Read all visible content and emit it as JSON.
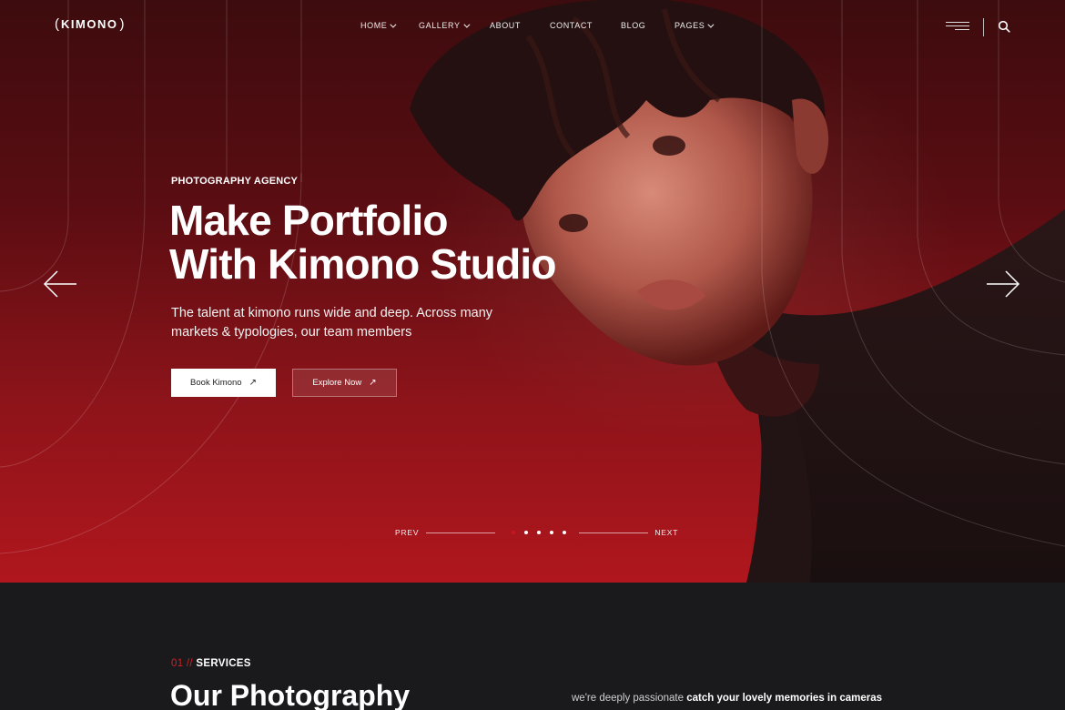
{
  "brand": {
    "logo_text": "KIMONO"
  },
  "nav": {
    "items": [
      {
        "label": "HOME",
        "dropdown": true
      },
      {
        "label": "GALLERY",
        "dropdown": true
      },
      {
        "label": "ABOUT",
        "dropdown": false
      },
      {
        "label": "CONTACT",
        "dropdown": false
      },
      {
        "label": "BLOG",
        "dropdown": false
      },
      {
        "label": "PAGES",
        "dropdown": true
      }
    ],
    "icons": [
      "hamburger-menu-icon",
      "search-icon"
    ]
  },
  "hero": {
    "eyebrow": "PHOTOGRAPHY AGENCY",
    "headline_line1": "Make Portfolio",
    "headline_line2": "With Kimono Studio",
    "lede": "The talent at kimono runs wide and deep. Across many markets & typologies, our team members",
    "book_label": "Book Kimono",
    "explore_label": "Explore Now",
    "prev_label": "PREV",
    "next_label": "NEXT",
    "slide_count": 5,
    "active_slide": 1
  },
  "services": {
    "number": "01 //",
    "tag": "SERVICES",
    "title": "Our Photography",
    "desc_plain": "we're deeply passionate",
    "desc_bold": "catch your lovely memories in cameras"
  },
  "colors": {
    "accent": "#c8161f",
    "hero_dark": "#3d0c0e",
    "hero_light": "#b0161d",
    "section_bg": "#1a1a1c"
  }
}
